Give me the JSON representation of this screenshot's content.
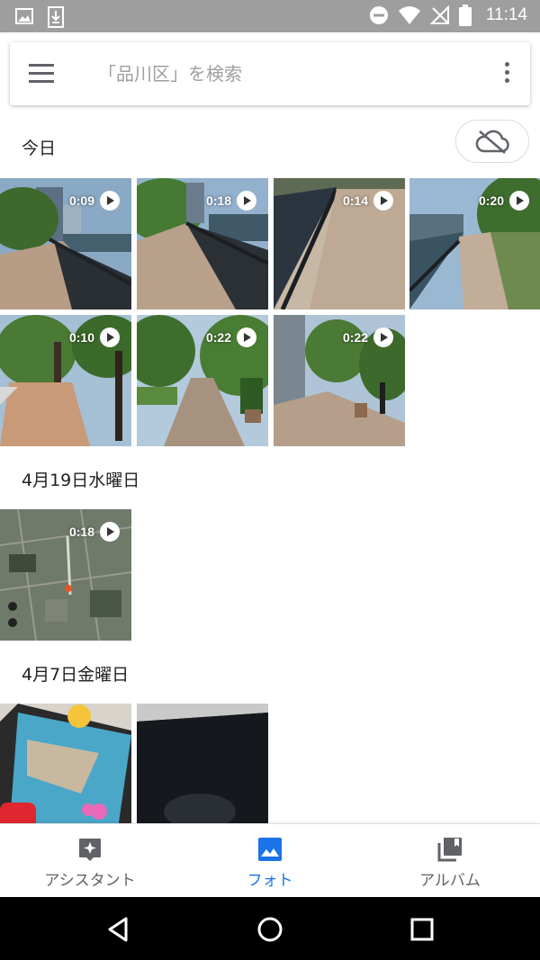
{
  "status_bar": {
    "time": "11:14",
    "left_icons": [
      "image-notification-icon",
      "download-notification-icon"
    ],
    "right_icons": [
      "do-not-disturb-icon",
      "wifi-icon",
      "no-signal-icon",
      "battery-icon"
    ]
  },
  "search": {
    "placeholder": "「品川区」を検索"
  },
  "sections": [
    {
      "title": "今日",
      "items": [
        {
          "duration": "0:09",
          "type": "video"
        },
        {
          "duration": "0:18",
          "type": "video"
        },
        {
          "duration": "0:14",
          "type": "video"
        },
        {
          "duration": "0:20",
          "type": "video"
        },
        {
          "duration": "0:10",
          "type": "video"
        },
        {
          "duration": "0:22",
          "type": "video"
        },
        {
          "duration": "0:22",
          "type": "video"
        }
      ]
    },
    {
      "title": "4月19日水曜日",
      "items": [
        {
          "duration": "0:18",
          "type": "video"
        }
      ]
    },
    {
      "title": "4月7日金曜日",
      "items": [
        {
          "type": "photo"
        },
        {
          "type": "photo"
        }
      ]
    }
  ],
  "bottom_nav": {
    "tabs": [
      {
        "label": "アシスタント",
        "icon": "assistant-icon",
        "active": false
      },
      {
        "label": "フォト",
        "icon": "photos-icon",
        "active": true
      },
      {
        "label": "アルバム",
        "icon": "albums-icon",
        "active": false
      }
    ]
  },
  "colors": {
    "accent": "#1a73e8",
    "status_bar": "#9e9e9e",
    "inactive": "#5f6368"
  }
}
